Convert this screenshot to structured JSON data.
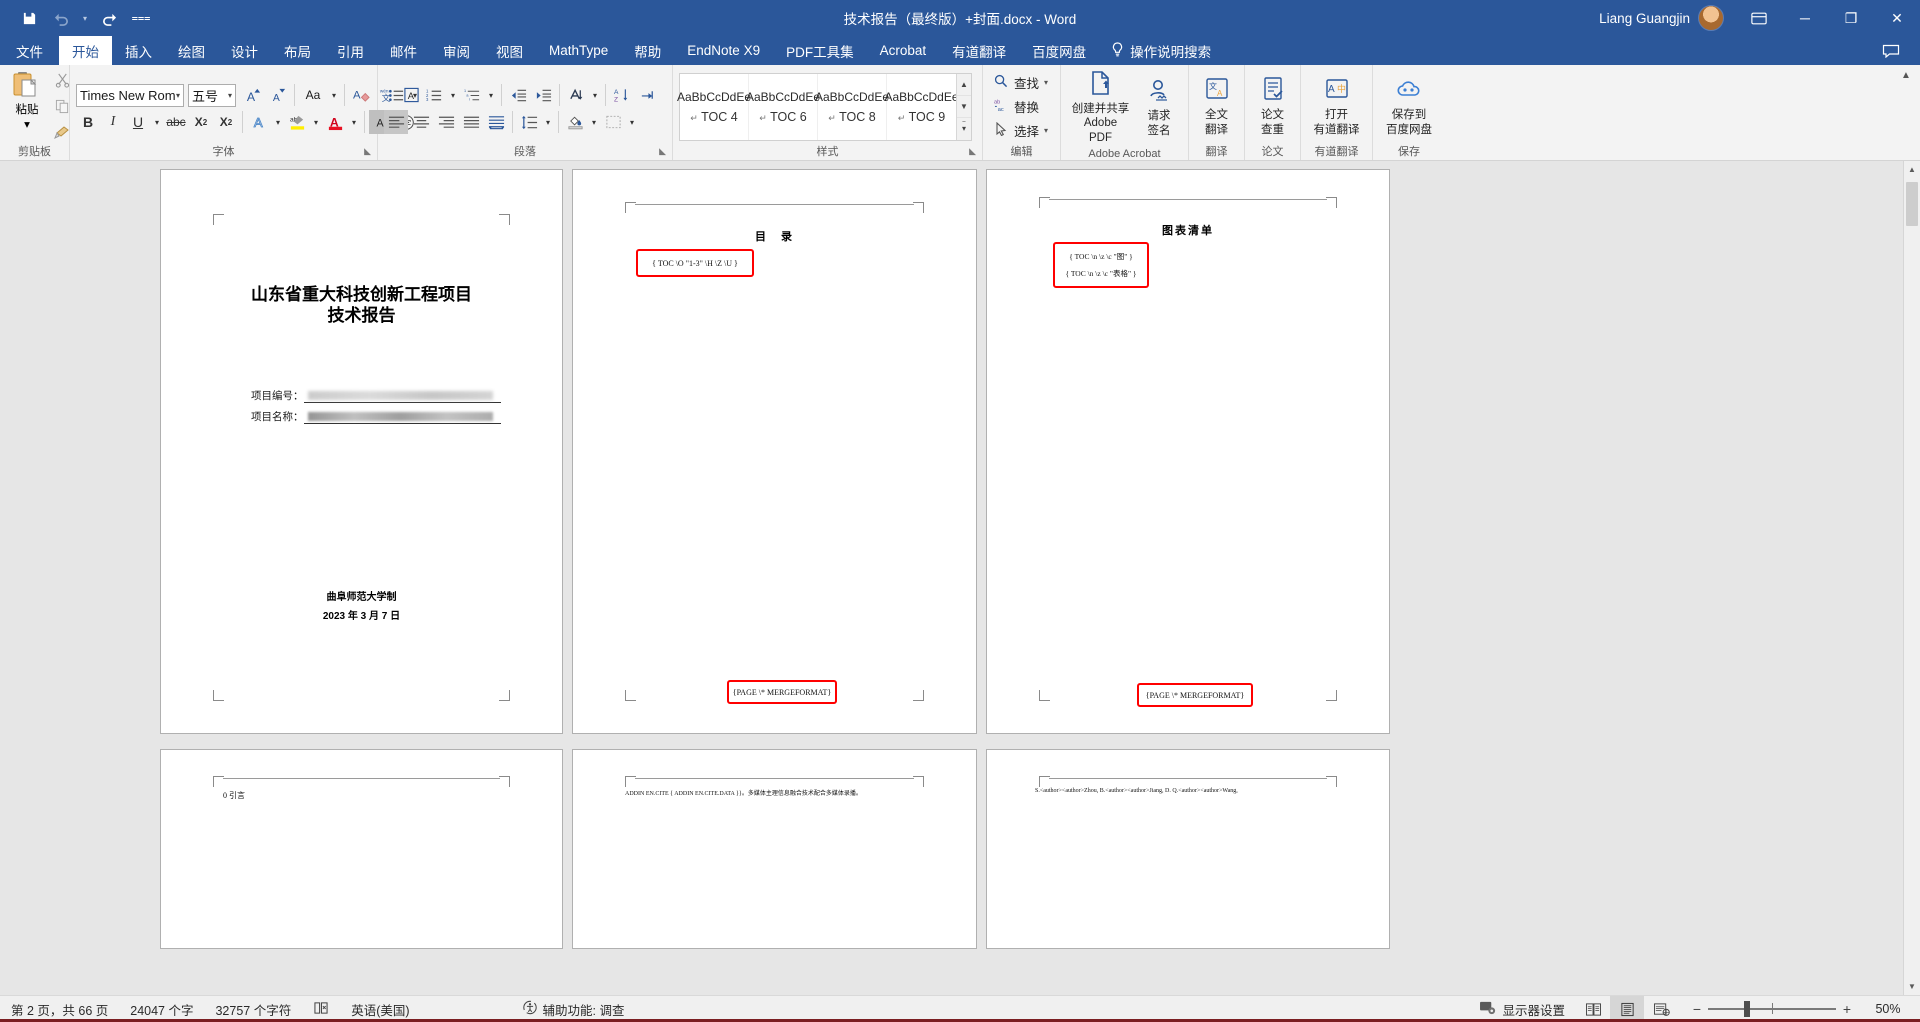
{
  "titlebar": {
    "quick_access": [
      {
        "name": "save-icon",
        "glyph": "💾",
        "label": "保存"
      },
      {
        "name": "undo-icon",
        "glyph": "↶",
        "label": "撤消"
      },
      {
        "name": "redo-icon",
        "glyph": "↷",
        "label": "恢复"
      },
      {
        "name": "customize-qat-icon",
        "glyph": "≔",
        "label": "自定义快速访问工具栏"
      }
    ],
    "document_title": "技术报告（最终版）+封面.docx  -  Word",
    "user_name": "Liang Guangjin",
    "ribbon_display_label": "功能区显示选项",
    "minimize_label": "─",
    "restore_label": "❐",
    "close_label": "✕"
  },
  "tabs": [
    {
      "label": "文件",
      "active": false
    },
    {
      "label": "开始",
      "active": true
    },
    {
      "label": "插入",
      "active": false
    },
    {
      "label": "绘图",
      "active": false
    },
    {
      "label": "设计",
      "active": false
    },
    {
      "label": "布局",
      "active": false
    },
    {
      "label": "引用",
      "active": false
    },
    {
      "label": "邮件",
      "active": false
    },
    {
      "label": "审阅",
      "active": false
    },
    {
      "label": "视图",
      "active": false
    },
    {
      "label": "MathType",
      "active": false
    },
    {
      "label": "帮助",
      "active": false
    },
    {
      "label": "EndNote X9",
      "active": false
    },
    {
      "label": "PDF工具集",
      "active": false
    },
    {
      "label": "Acrobat",
      "active": false
    },
    {
      "label": "有道翻译",
      "active": false
    },
    {
      "label": "百度网盘",
      "active": false
    }
  ],
  "tell_me": {
    "label": "操作说明搜索",
    "icon": "lightbulb-icon"
  },
  "comments_label": "批注",
  "ribbon": {
    "clipboard": {
      "group_label": "剪贴板",
      "paste_label": "粘贴",
      "cut_label": "剪切",
      "copy_label": "复制",
      "format_painter_label": "格式刷"
    },
    "font": {
      "group_label": "字体",
      "font_name": "Times New Rom",
      "font_size": "五号",
      "grow_font": "A",
      "shrink_font": "A",
      "change_case": "Aa",
      "clear_format": "清除所有格式",
      "phonetic": "拼音指南",
      "char_border": "字符边框",
      "bold": "B",
      "italic": "I",
      "underline": "U",
      "strikethrough": "abc",
      "subscript": "X₂",
      "superscript": "X²",
      "text_effects": "A",
      "highlight": "ab",
      "font_color": "A",
      "char_shading": "A",
      "enclose_char": "字"
    },
    "paragraph": {
      "group_label": "段落",
      "bullets": "项目符号",
      "numbering": "编号",
      "multilevel": "多级列表",
      "decrease_indent": "减少缩进量",
      "increase_indent": "增加缩进量",
      "sort": "排序",
      "show_marks": "显示编辑标记",
      "align_left": "左对齐",
      "align_center": "居中",
      "align_right": "右对齐",
      "justify": "两端对齐",
      "distribute": "分散对齐",
      "line_spacing": "行和段落间距",
      "shading": "底纹",
      "borders": "边框"
    },
    "styles": {
      "group_label": "样式",
      "items": [
        {
          "sample": "AaBbCcDdEe",
          "name": "TOC 4",
          "mark": "↵"
        },
        {
          "sample": "AaBbCcDdEe",
          "name": "TOC 6",
          "mark": "↵"
        },
        {
          "sample": "AaBbCcDdEe",
          "name": "TOC 8",
          "mark": "↵"
        },
        {
          "sample": "AaBbCcDdEe",
          "name": "TOC 9",
          "mark": "↵"
        }
      ]
    },
    "editing": {
      "group_label": "编辑",
      "find_label": "查找",
      "replace_label": "替换",
      "select_label": "选择"
    },
    "acrobat": {
      "group_label": "Adobe Acrobat",
      "create_share_label_1": "创建并共享",
      "create_share_label_2": "Adobe PDF",
      "request_sign_label_1": "请求",
      "request_sign_label_2": "签名"
    },
    "translate": {
      "group_label": "翻译",
      "full_text_1": "全文",
      "full_text_2": "翻译"
    },
    "paper": {
      "group_label": "论文",
      "check_1": "论文",
      "check_2": "查重"
    },
    "youdao": {
      "group_label": "有道翻译",
      "open_1": "打开",
      "open_2": "有道翻译"
    },
    "save_group": {
      "group_label": "保存",
      "save_1": "保存到",
      "save_2": "百度网盘"
    }
  },
  "document": {
    "pages": [
      {
        "kind": "cover",
        "title_line1": "山东省重大科技创新工程项目",
        "title_line2": "技术报告",
        "fields": [
          {
            "label": "项目编号：",
            "value_masked": true
          },
          {
            "label": "项目名称：",
            "value_masked": true
          }
        ],
        "footer_line1": "曲阜师范大学制",
        "footer_line2": "2023 年 3 月 7 日"
      },
      {
        "kind": "toc",
        "heading": "目　录",
        "field_codes": [
          "{ TOC \\O \"1-3\" \\H \\Z \\U }"
        ],
        "page_field": "{PAGE   \\* MERGEFORMAT}",
        "next_page_preview": "ADDIN EN.CITE  { ADDIN EN.CITE.DATA }}。多媒体主理信息融合技术配合多媒体录播。"
      },
      {
        "kind": "figure-list",
        "heading": "图表清单",
        "field_codes": [
          "{ TOC \\n \\z \\c \"图\" }",
          "{ TOC \\n \\z \\c \"表格\" }"
        ],
        "page_field": "{PAGE   \\* MERGEFORMAT}",
        "next_page_preview": "S.<author><author>Zhou,   B.<author><author>Jiang,   D.   Q.<author><author>Wang,"
      },
      {
        "kind": "body",
        "heading": "0 引言"
      }
    ]
  },
  "statusbar": {
    "page_info": "第 2 页，共 66 页",
    "word_count": "24047 个字",
    "char_count": "32757 个字符",
    "proofing_icon": "spellcheck-icon",
    "language": "英语(美国)",
    "accessibility": "辅助功能: 调查",
    "display_settings": "显示器设置",
    "views": [
      {
        "name": "read-mode-view",
        "glyph": "📖",
        "active": false
      },
      {
        "name": "print-layout-view",
        "glyph": "☰",
        "active": true
      },
      {
        "name": "web-layout-view",
        "glyph": "☷",
        "active": false
      }
    ],
    "zoom_out": "−",
    "zoom_in": "+",
    "zoom_level": "50%"
  }
}
